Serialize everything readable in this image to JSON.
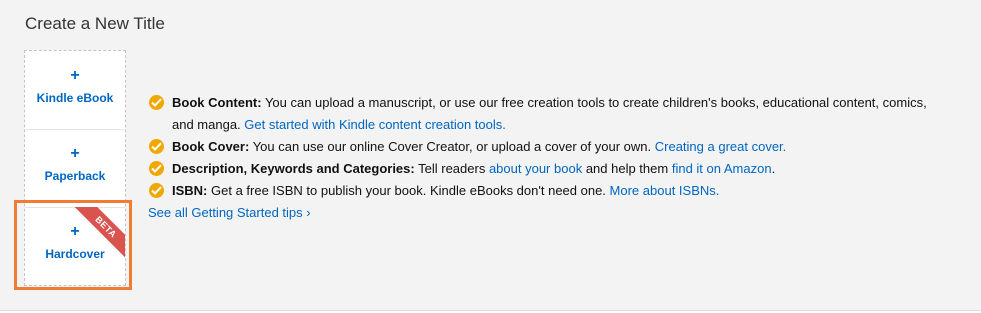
{
  "section": {
    "title": "Create a New Title"
  },
  "options": [
    {
      "plus": "+",
      "label": "Kindle eBook"
    },
    {
      "plus": "+",
      "label": "Paperback"
    },
    {
      "plus": "+",
      "label": "Hardcover",
      "badge": "BETA"
    }
  ],
  "tips": {
    "book_content": {
      "heading": "Book Content:",
      "text": "You can upload a manuscript, or use our free creation tools to create children's books, educational content, comics,",
      "text2": "and manga.",
      "link": "Get started with Kindle content creation tools."
    },
    "book_cover": {
      "heading": "Book Cover:",
      "text": "You can use our online Cover Creator, or upload a cover of your own.",
      "link": "Creating a great cover."
    },
    "description": {
      "heading": "Description, Keywords and Categories:",
      "text1": "Tell readers",
      "link1": "about your book",
      "text2": "and help them",
      "link2": "find it on Amazon",
      "text3": "."
    },
    "isbn": {
      "heading": "ISBN:",
      "text": "Get a free ISBN to publish your book. Kindle eBooks don't need one.",
      "link": "More about ISBNs."
    },
    "see_all": "See all Getting Started tips ›"
  },
  "colors": {
    "accent_link": "#0066c0",
    "check": "#f0a800",
    "highlight": "#ef7c32",
    "badge": "#d9534f"
  }
}
